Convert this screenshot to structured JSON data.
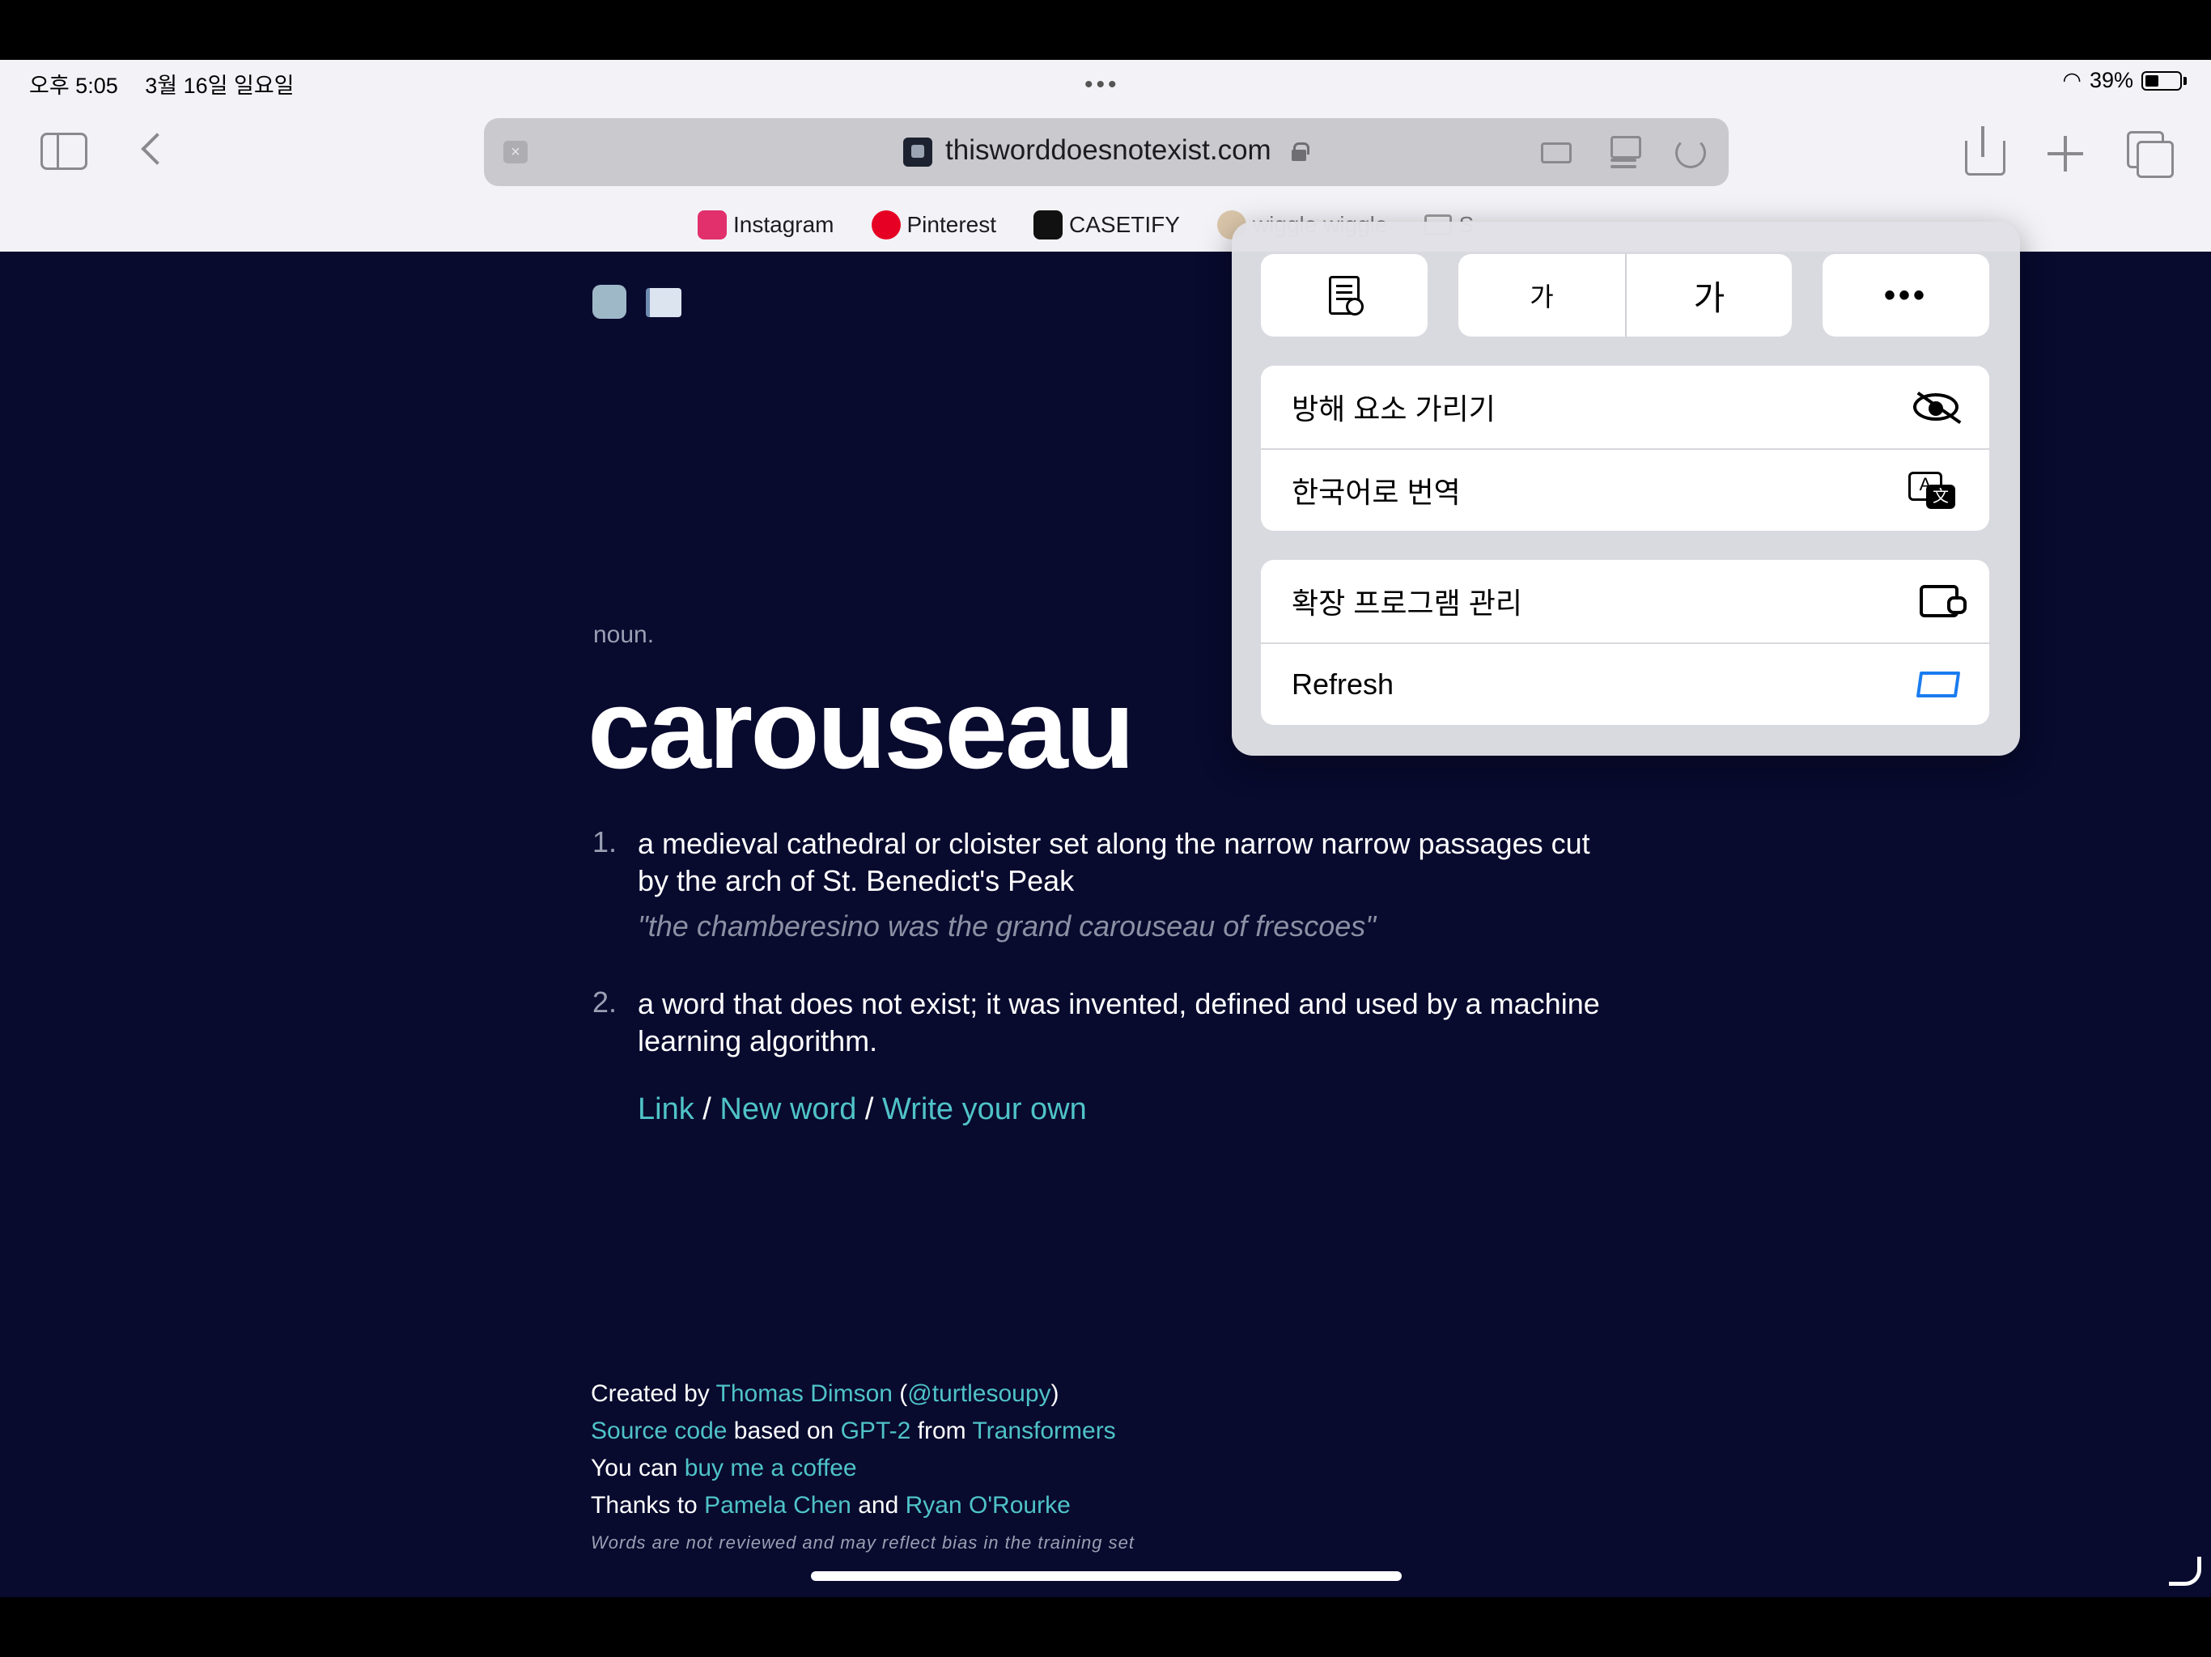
{
  "status": {
    "time": "오후 5:05",
    "date": "3월 16일 일요일",
    "battery": "39%"
  },
  "url_bar": {
    "domain": "thisworddoesnotexist.com"
  },
  "bookmarks": [
    {
      "label": "Instagram"
    },
    {
      "label": "Pinterest"
    },
    {
      "label": "CASETIFY"
    },
    {
      "label": "wiggle wiggle"
    },
    {
      "label": "S"
    }
  ],
  "page": {
    "part_of_speech": "noun.",
    "word": "carouseau",
    "definitions": [
      {
        "num": "1.",
        "text": "a medieval cathedral or cloister set along the narrow narrow passages cut by the arch of St. Benedict's Peak",
        "example": "\"the chamberesino was the grand carouseau of frescoes\""
      },
      {
        "num": "2.",
        "text": "a word that does not exist; it was invented, defined and used by a machine learning algorithm."
      }
    ],
    "actions": {
      "link": "Link",
      "sep": "/",
      "new_word": "New word",
      "write_own": "Write your own"
    }
  },
  "footer": {
    "created_by": "Created by",
    "author": "Thomas Dimson",
    "paren_open": "(",
    "handle": "@turtlesoupy",
    "paren_close": ")",
    "source_code": "Source code",
    "based_on": "based on",
    "gpt2": "GPT-2",
    "from": "from",
    "transformers": "Transformers",
    "you_can": "You can",
    "coffee": "buy me a coffee",
    "thanks_to": "Thanks to",
    "pamela": "Pamela Chen",
    "and": "and",
    "ryan": "Ryan O'Rourke",
    "disclaimer": "Words are not reviewed and may reflect bias in the training set"
  },
  "menu": {
    "font_small": "가",
    "font_large": "가",
    "more": "•••",
    "items_group1": [
      {
        "label": "방해 요소 가리기",
        "icon": "eye-slash-icon"
      },
      {
        "label": "한국어로 번역",
        "icon": "translate-icon"
      }
    ],
    "items_group2": [
      {
        "label": "확장 프로그램 관리",
        "icon": "extension-icon"
      },
      {
        "label": "Refresh",
        "icon": "refresh-extension-icon"
      }
    ]
  },
  "colors": {
    "page_bg": "#080a2e",
    "link": "#4fc3c8",
    "accent": "#1a7cf0"
  }
}
